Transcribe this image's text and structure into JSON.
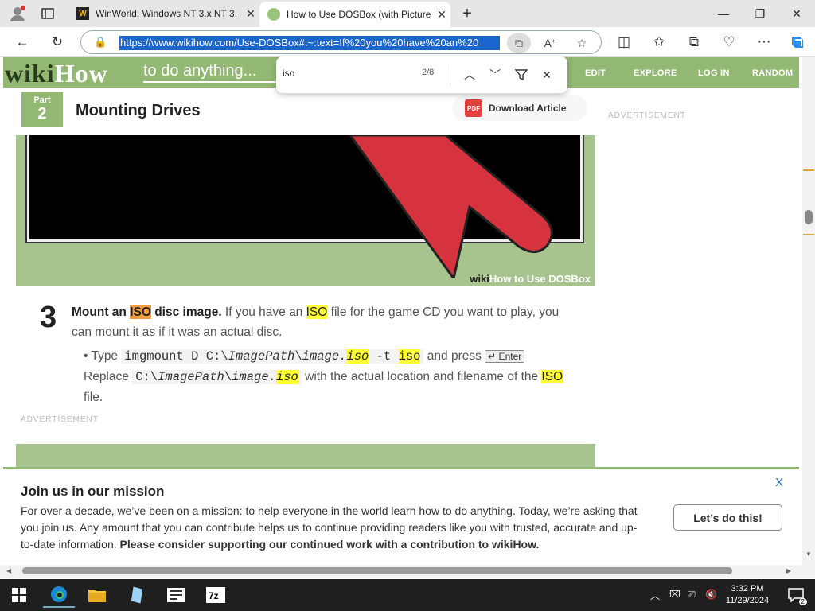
{
  "tabs": [
    {
      "title": "WinWorld: Windows NT 3.x NT 3.",
      "favicon": "W"
    },
    {
      "title": "How to Use DOSBox (with Picture",
      "active": true
    }
  ],
  "toolbar": {
    "url": "https://www.wikihow.com/Use-DOSBox#:~:text=If%20you%20have%20an%20"
  },
  "find": {
    "query": "iso",
    "count": "2/8"
  },
  "site": {
    "logo_a": "wiki",
    "logo_b": "How",
    "tagline": "to do anything...",
    "nav": [
      "EDIT",
      "EXPLORE",
      "LOG IN",
      "RANDOM"
    ],
    "advertisement": "ADVERTISEMENT"
  },
  "article": {
    "part_label": "Part",
    "part_num": "2",
    "part_title": "Mounting Drives",
    "download": "Download Article",
    "pdf_icon_text": "PDF",
    "image_watermark_a": "wiki",
    "image_watermark_b": "How",
    "image_watermark_c": " to Use DOSBox",
    "step_num": "3",
    "step_lead_a": "Mount an ",
    "step_lead_iso": "ISO",
    "step_lead_b": " disc image.",
    "step_text_a": " If you have an ",
    "step_text_iso": "ISO",
    "step_text_b": " file for the game CD you want to play, you can mount it as if it was an actual disc.",
    "bullet_type": "Type ",
    "code_a": "imgmount D C:\\",
    "code_path": "ImagePath",
    "code_sep": "\\",
    "code_image": "image.",
    "code_iso": "iso",
    "code_b": " -t ",
    "code_iso2": "iso",
    "bullet_press": " and press ",
    "enter_key": "↵ Enter",
    "bullet_replace": " Replace ",
    "replace_code_a": "C:\\",
    "replace_path": "ImagePath",
    "replace_sep": "\\",
    "replace_image": "image.",
    "replace_iso": "iso",
    "bullet_rest": " with the actual location and filename of the ",
    "bullet_iso": "ISO",
    "bullet_end": " file."
  },
  "banner": {
    "title": "Join us in our mission",
    "text": "For over a decade, we’ve been on a mission: to help everyone in the world learn how to do anything. Today, we’re asking that you join us. Any amount that you can contribute helps us to continue providing readers like you with trusted, accurate and up-to-date information. ",
    "text_bold": "Please consider supporting our continued work with a contribution to wikiHow.",
    "button": "Let’s do this!",
    "close": "X"
  },
  "taskbar": {
    "time": "3:32 PM",
    "date": "11/29/2024",
    "notif_count": "2"
  },
  "colors": {
    "wikihow_green": "#93b874",
    "highlight": "#ffff33",
    "active_highlight": "#f59b3b",
    "url_selection": "#1a66cc"
  }
}
